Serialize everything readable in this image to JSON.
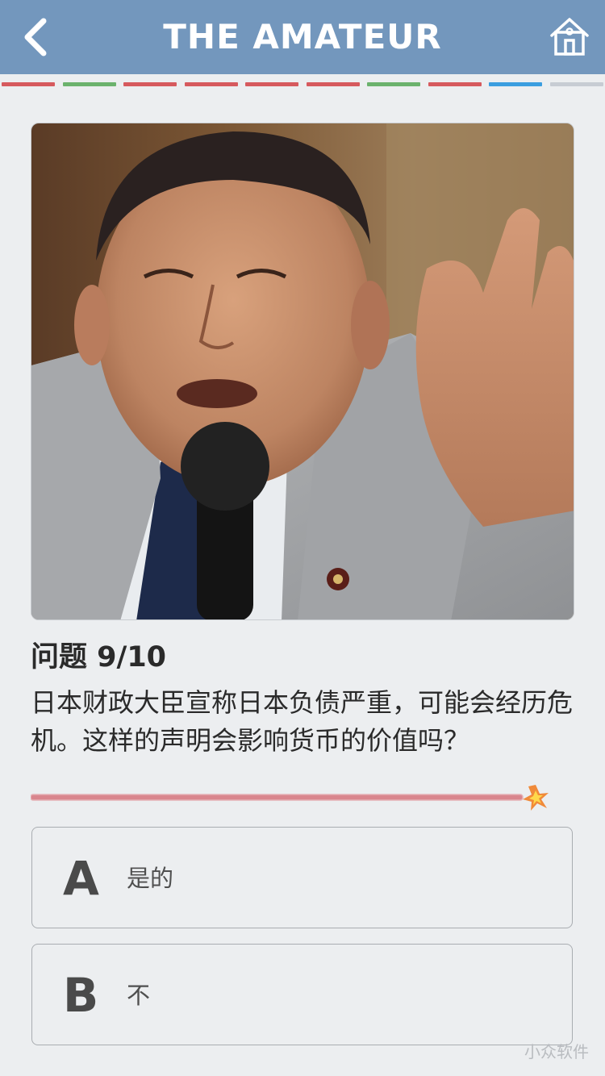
{
  "header": {
    "title": "THE AMATEUR",
    "back_icon": "chevron-left-icon",
    "home_icon": "home-icon",
    "background_color": "#7397bd"
  },
  "progress": {
    "segments": [
      {
        "status": "wrong",
        "color": "#d65a5e"
      },
      {
        "status": "correct",
        "color": "#6bb26d"
      },
      {
        "status": "wrong",
        "color": "#d65a5e"
      },
      {
        "status": "wrong",
        "color": "#d65a5e"
      },
      {
        "status": "wrong",
        "color": "#d65a5e"
      },
      {
        "status": "wrong",
        "color": "#d65a5e"
      },
      {
        "status": "correct",
        "color": "#6bb26d"
      },
      {
        "status": "wrong",
        "color": "#d65a5e"
      },
      {
        "status": "current",
        "color": "#3b9ee0"
      },
      {
        "status": "pending",
        "color": "#c7ccd3"
      }
    ]
  },
  "question": {
    "number_label": "问题 9/10",
    "text": "日本财政大臣宣称日本负债严重，可能会经历危机。这样的声明会影响货币的价值吗？"
  },
  "timer": {
    "remaining_fraction": 1.0,
    "color": "#d9868e"
  },
  "options": [
    {
      "letter": "A",
      "text": "是的"
    },
    {
      "letter": "B",
      "text": "不"
    }
  ],
  "watermark": "小众软件"
}
